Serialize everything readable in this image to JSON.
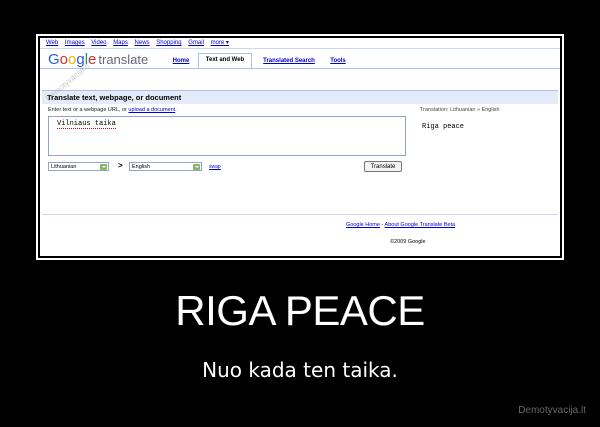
{
  "topnav": [
    "Web",
    "Images",
    "Video",
    "Maps",
    "News",
    "Shopping",
    "Gmail",
    "more ▾"
  ],
  "logo": {
    "google": "Google",
    "product": "translate"
  },
  "tabs": [
    {
      "label": "Home",
      "active": false
    },
    {
      "label": "Text and Web",
      "active": true
    },
    {
      "label": "Translated Search",
      "active": false
    },
    {
      "label": "Tools",
      "active": false
    }
  ],
  "panel": {
    "title": "Translate text, webpage, or document",
    "hint_prefix": "Enter text or a webpage URL, or ",
    "hint_link": "upload a document",
    "hint_suffix": "."
  },
  "source_text": "Vilniaus taika",
  "result": {
    "label": "Translation:",
    "lang_pair": "Lithuanian » English",
    "text": "Riga peace"
  },
  "from_language": "Lithuanian",
  "arrow": ">",
  "to_language": "English",
  "swap_label": "swap",
  "translate_button": "Translate",
  "footer": {
    "link1": "Google Home",
    "dash": " - ",
    "link2": "About Google Translate Beta",
    "copyright": "©2009 Google"
  },
  "watermark": "Demotyvacija.lt",
  "poster": {
    "headline": "RIGA PEACE",
    "subline": "Nuo kada ten taika.",
    "site": "Demotyvacija.lt"
  }
}
